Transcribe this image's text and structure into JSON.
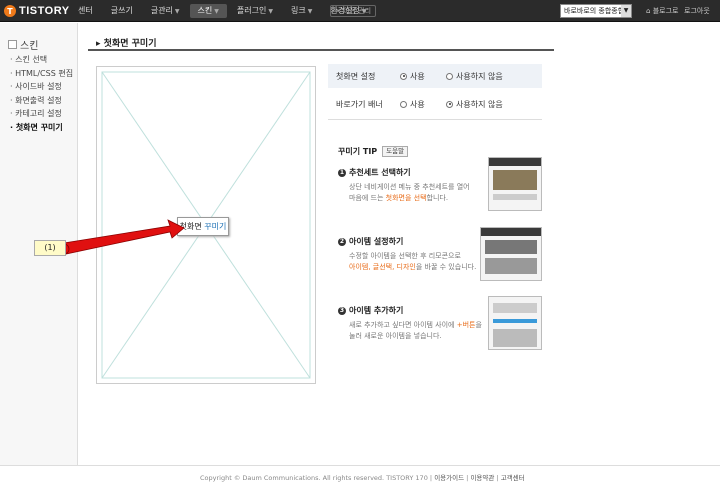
{
  "topbar": {
    "logo_text": "TISTORY",
    "logo_mark": "T",
    "nav": [
      {
        "label": "센터"
      },
      {
        "label": "글쓰기"
      },
      {
        "label": "글관리",
        "dropdown": true
      },
      {
        "label": "스킨",
        "dropdown": true,
        "active": true
      },
      {
        "label": "플러그인",
        "dropdown": true
      },
      {
        "label": "링크",
        "dropdown": true
      },
      {
        "label": "환경설정",
        "dropdown": true
      }
    ],
    "old_admin": "× 이전 관리",
    "blog_select": "바로바로의 종합종합",
    "blog_link": "블로그로",
    "logout_link": "로그아웃"
  },
  "sidebar": {
    "title": "스킨",
    "items": [
      "· 스킨 선택",
      "· HTML/CSS 편집",
      "· 사이드바 설정",
      "· 화면출력 설정",
      "· 카테고리 설정",
      "· 첫화면 꾸미기"
    ]
  },
  "main": {
    "page_title": "첫화면 꾸미기",
    "preview_button_prefix": "첫화면 ",
    "preview_button_highlight": "꾸미기",
    "callout": "(1)"
  },
  "settings": {
    "rows": [
      {
        "label": "첫화면 설정",
        "opt1": "사용",
        "opt2": "사용하지 않음",
        "selected": 1
      },
      {
        "label": "바로가기 배너",
        "opt1": "사용",
        "opt2": "사용하지 않음",
        "selected": 2
      }
    ]
  },
  "tips": {
    "head": "꾸미기 TIP",
    "help": "도움말",
    "items": [
      {
        "num": "1",
        "title": "추천세트 선택하기",
        "line1": "상단 네비게이션 메뉴 중 추천세트를 열어",
        "line2_pre": "마음에 드는 ",
        "line2_hl": "첫화면을 선택",
        "line2_post": "합니다."
      },
      {
        "num": "2",
        "title": "아이템 설정하기",
        "line1": "수정할 아이템을 선택한 후 리모콘으로",
        "line2_hl": "아이템, 글선택, 디자인",
        "line2_post": "을 바꿀 수 있습니다."
      },
      {
        "num": "3",
        "title": "아이템 추가하기",
        "line1_pre": "새로 추가하고 싶다면 아이템 사이에 ",
        "line1_hl": "+버튼",
        "line1_post": "을",
        "line2": "눌러 새로운 아이템을 넣습니다."
      }
    ]
  },
  "footer": {
    "copyright": "Copyright © Daum Communications. All rights reserved. TISTORY 170",
    "guide": "이용가이드",
    "terms": "이용약관",
    "support": "고객센터"
  },
  "colors": {
    "accent": "#e86c1a",
    "topbar": "#2b2b2b",
    "arrow": "#e01010",
    "callout_bg": "#fffbc8"
  }
}
